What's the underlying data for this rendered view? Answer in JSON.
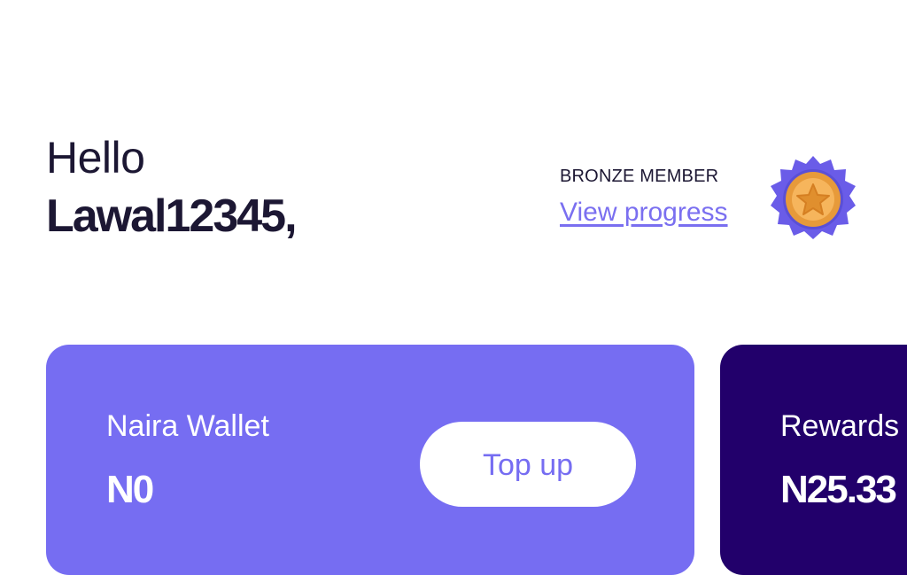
{
  "greeting": {
    "hello": "Hello",
    "username": "Lawal12345,"
  },
  "membership": {
    "tier": "BRONZE MEMBER",
    "progress_link": "View progress",
    "badge_icon": "bronze-medal-star-icon",
    "colors": {
      "badge_outer": "#6a5ce8",
      "badge_ring": "#e79a3a",
      "badge_inner": "#f6b55c"
    }
  },
  "wallet_card": {
    "label": "Naira Wallet",
    "amount": "N0",
    "topup_label": "Top up",
    "color": "#766df2"
  },
  "rewards_card": {
    "label": "Rewards",
    "amount": "N25.33",
    "color": "#22006b"
  }
}
